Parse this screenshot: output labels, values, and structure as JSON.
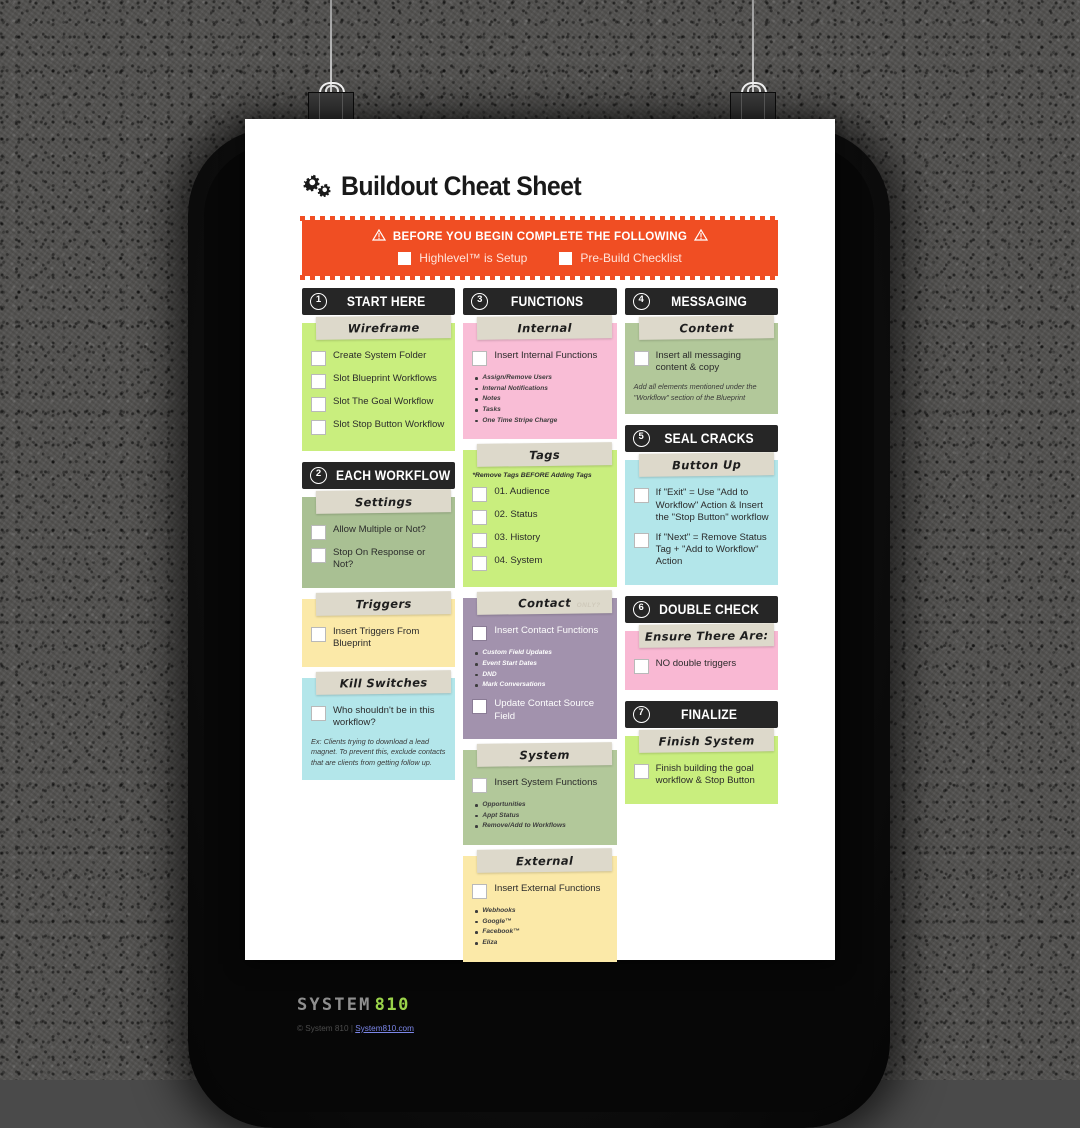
{
  "document": {
    "title": "Buildout Cheat Sheet",
    "title_icon": "gears-icon"
  },
  "banner": {
    "heading": "BEFORE YOU BEGIN COMPLETE THE FOLLOWING",
    "warning_icon": "warning-triangle-icon",
    "color": "#f04e23",
    "options": [
      {
        "label": "Highlevel™ is Setup",
        "checked": false
      },
      {
        "label": "Pre-Build Checklist",
        "checked": false
      }
    ]
  },
  "columns": [
    {
      "id": "column-left",
      "sections": [
        {
          "step": {
            "number": "1",
            "label": "START HERE"
          },
          "blocks": [
            {
              "tape_label": "Wireframe",
              "color": "#c9ee7e",
              "color_class": "c-lime",
              "checks": [
                {
                  "label": "Create System Folder",
                  "checked": false
                },
                {
                  "label": "Slot Blueprint Workflows",
                  "checked": false
                },
                {
                  "label": "Slot The Goal Workflow",
                  "checked": false
                },
                {
                  "label": "Slot Stop Button Workflow",
                  "checked": false
                }
              ],
              "bullets": [],
              "note": "",
              "subnote": ""
            }
          ]
        },
        {
          "step": {
            "number": "2",
            "label": "EACH WORKFLOW"
          },
          "blocks": [
            {
              "tape_label": "Settings",
              "color": "#a9c093",
              "color_class": "c-sage",
              "checks": [
                {
                  "label": "Allow Multiple or Not?",
                  "checked": false
                },
                {
                  "label": "Stop On Response or Not?",
                  "checked": false
                }
              ],
              "bullets": [],
              "note": "",
              "subnote": ""
            },
            {
              "tape_label": "Triggers",
              "color": "#fbe9a8",
              "color_class": "c-cream",
              "checks": [
                {
                  "label": "Insert Triggers From Blueprint",
                  "checked": false
                }
              ],
              "bullets": [],
              "note": "",
              "subnote": ""
            },
            {
              "tape_label": "Kill Switches",
              "color": "#b3e6ea",
              "color_class": "c-aqua",
              "checks": [
                {
                  "label": "Who shouldn't be in this workflow?",
                  "checked": false
                }
              ],
              "bullets": [],
              "note": "Ex: Clients trying to download a lead magnet. To prevent this, exclude contacts that are clients from getting follow up.",
              "subnote": ""
            }
          ]
        }
      ]
    },
    {
      "id": "column-middle",
      "sections": [
        {
          "step": {
            "number": "3",
            "label": "FUNCTIONS"
          },
          "blocks": [
            {
              "tape_label": "Internal",
              "color": "#f9bdd6",
              "color_class": "c-pink",
              "checks": [
                {
                  "label": "Insert Internal Functions",
                  "checked": false
                }
              ],
              "bullets": [
                "Assign/Remove Users",
                "Internal Notifications",
                "Notes",
                "Tasks",
                "One Time Stripe Charge"
              ],
              "note": "",
              "subnote": ""
            },
            {
              "tape_label": "Tags",
              "color": "#c9ee7e",
              "color_class": "c-lime",
              "checks": [
                {
                  "label": "01. Audience",
                  "checked": false
                },
                {
                  "label": "02. Status",
                  "checked": false
                },
                {
                  "label": "03. History",
                  "checked": false
                },
                {
                  "label": "04. System",
                  "checked": false
                }
              ],
              "bullets": [],
              "note": "",
              "subnote": "*Remove Tags BEFORE Adding Tags"
            },
            {
              "tape_label": "Contact",
              "tape_ghost": "ONLY?",
              "color": "#a292ad",
              "color_class": "c-purple",
              "checks": [
                {
                  "label": "Insert Contact Functions",
                  "checked": false
                },
                {
                  "label": "Update Contact Source Field",
                  "checked": false
                }
              ],
              "bullets": [
                "Custom Field Updates",
                "Event Start Dates",
                "DND",
                "Mark Conversations"
              ],
              "note": "",
              "subnote": ""
            },
            {
              "tape_label": "System",
              "color": "#b2c89a",
              "color_class": "c-green2",
              "checks": [
                {
                  "label": "Insert System Functions",
                  "checked": false
                }
              ],
              "bullets": [
                "Opportunities",
                "Appt Status",
                "Remove/Add to Workflows"
              ],
              "note": "",
              "subnote": ""
            },
            {
              "tape_label": "External",
              "color": "#fbe9a8",
              "color_class": "c-cream",
              "checks": [
                {
                  "label": "Insert External Functions",
                  "checked": false
                }
              ],
              "bullets": [
                "Webhooks",
                "Google™",
                "Facebook™",
                "Eliza"
              ],
              "note": "",
              "subnote": ""
            }
          ]
        }
      ]
    },
    {
      "id": "column-right",
      "sections": [
        {
          "step": {
            "number": "4",
            "label": "MESSAGING"
          },
          "blocks": [
            {
              "tape_label": "Content",
              "color": "#b2c89a",
              "color_class": "c-green2",
              "checks": [
                {
                  "label": "Insert all messaging content & copy",
                  "checked": false
                }
              ],
              "bullets": [],
              "note": "Add all elements mentioned under the \"Workflow\" section of the Blueprint",
              "subnote": ""
            }
          ]
        },
        {
          "step": {
            "number": "5",
            "label": "SEAL CRACKS"
          },
          "blocks": [
            {
              "tape_label": "Button Up",
              "color": "#b3e6ea",
              "color_class": "c-aqua",
              "checks": [
                {
                  "label": "If \"Exit\" = Use \"Add to Workflow\" Action & Insert the \"Stop Button\" workflow",
                  "checked": false
                },
                {
                  "label": "If \"Next\" = Remove Status Tag + \"Add to Workflow\" Action",
                  "checked": false
                }
              ],
              "bullets": [],
              "note": "",
              "subnote": ""
            }
          ]
        },
        {
          "step": {
            "number": "6",
            "label": "DOUBLE CHECK"
          },
          "blocks": [
            {
              "tape_label": "Ensure There Are:",
              "color": "#f9b8d3",
              "color_class": "c-pink2",
              "checks": [
                {
                  "label": "NO double triggers",
                  "checked": false
                }
              ],
              "bullets": [],
              "note": "",
              "subnote": ""
            }
          ]
        },
        {
          "step": {
            "number": "7",
            "label": "FINALIZE"
          },
          "blocks": [
            {
              "tape_label": "Finish System",
              "color": "#c9ee7e",
              "color_class": "c-lime",
              "checks": [
                {
                  "label": "Finish building the goal workflow & Stop Button",
                  "checked": false
                }
              ],
              "bullets": [],
              "note": "",
              "subnote": ""
            }
          ]
        }
      ]
    }
  ],
  "footer": {
    "logo_word": "SYSTEM",
    "logo_number": "810",
    "copyright_prefix": "© System 810 | ",
    "link_text": "System810.com"
  }
}
